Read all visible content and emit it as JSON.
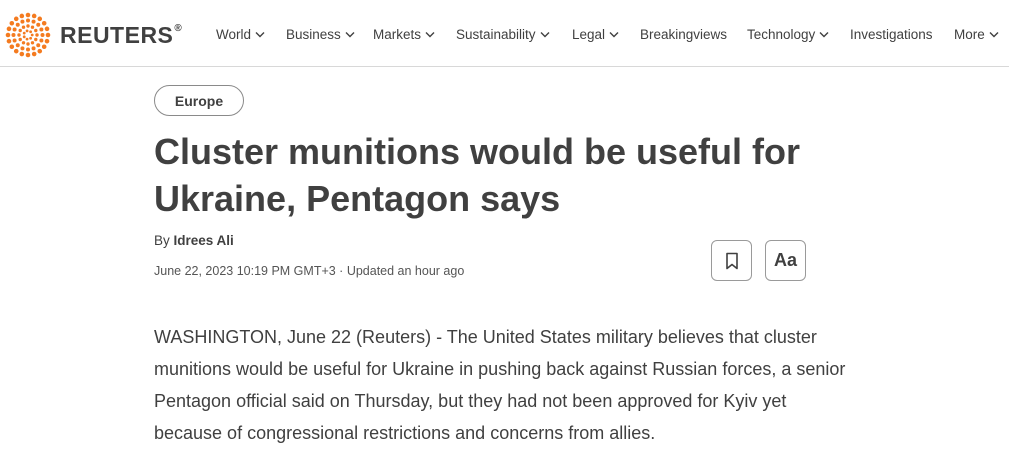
{
  "brand": {
    "name": "REUTERS",
    "reg": "®"
  },
  "nav": {
    "items": [
      {
        "label": "World",
        "dropdown": true
      },
      {
        "label": "Business",
        "dropdown": true
      },
      {
        "label": "Markets",
        "dropdown": true
      },
      {
        "label": "Sustainability",
        "dropdown": true
      },
      {
        "label": "Legal",
        "dropdown": true
      },
      {
        "label": "Breakingviews",
        "dropdown": false
      },
      {
        "label": "Technology",
        "dropdown": true
      },
      {
        "label": "Investigations",
        "dropdown": false
      },
      {
        "label": "More",
        "dropdown": true
      }
    ]
  },
  "article": {
    "section_tag": "Europe",
    "headline": "Cluster munitions would be useful for Ukraine, Pentagon says",
    "by_prefix": "By",
    "author": "Idrees Ali",
    "dateline": "June 22, 2023 10:19 PM GMT+3 · Updated an hour ago",
    "font_button_label": "Aa",
    "body": "WASHINGTON, June 22 (Reuters) - The United States military believes that cluster munitions would be useful for Ukraine in pushing back against Russian forces, a senior Pentagon official said on Thursday, but they had not been approved for Kyiv yet because of congressional restrictions and concerns from allies."
  },
  "colors": {
    "brand_orange": "#f47b20",
    "text": "#404040",
    "border": "#d8d8d8"
  },
  "icons": {
    "bookmark": "bookmark-icon",
    "dropdown": "chevron-down-icon",
    "logo": "reuters-dot-logo"
  }
}
